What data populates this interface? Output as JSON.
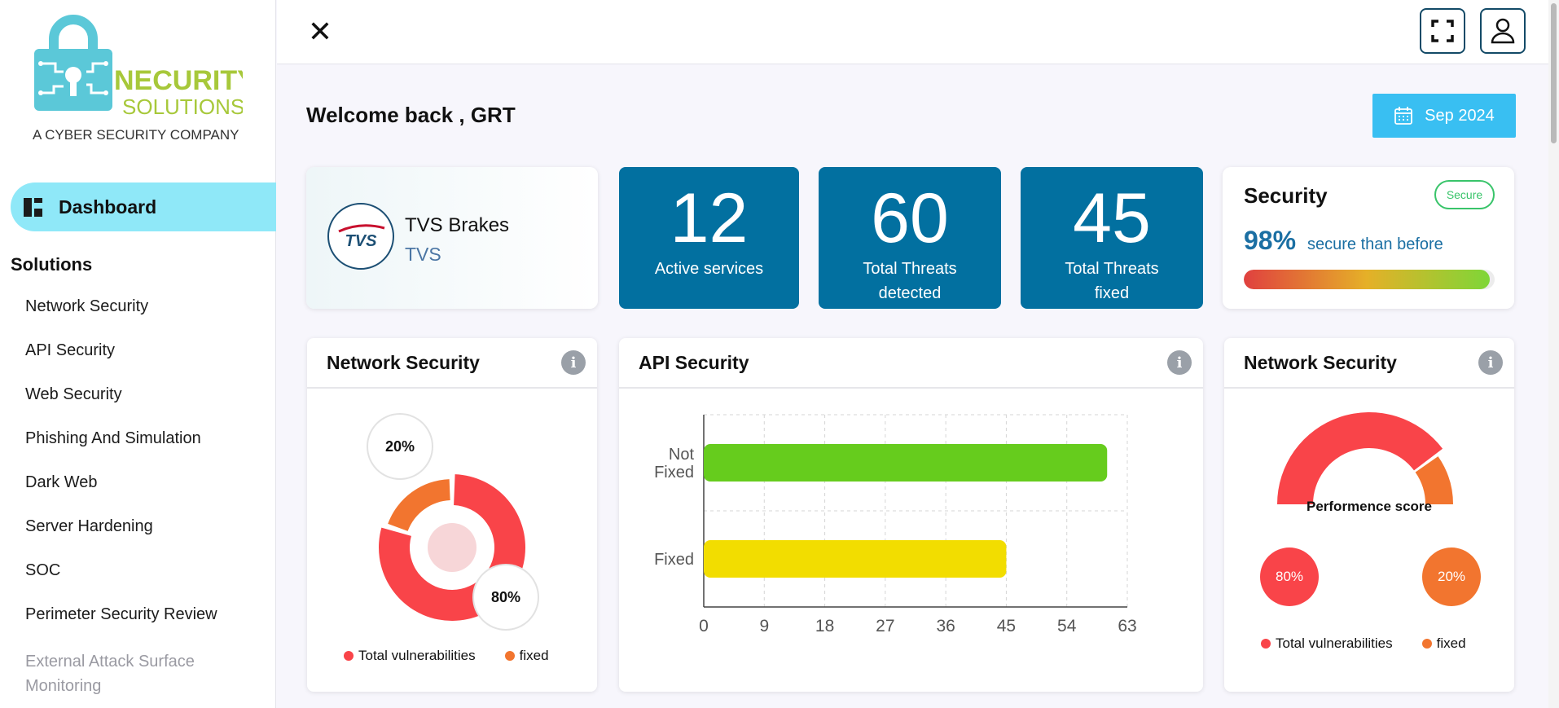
{
  "brand": {
    "name_line1": "NECURITY",
    "name_line2": "SOLUTIONS",
    "tagline": "A CYBER SECURITY COMPANY",
    "colors": {
      "teal": "#5bc8d8",
      "green": "#a7c83a"
    }
  },
  "sidebar": {
    "active_item": "Dashboard",
    "section_title": "Solutions",
    "items": [
      "Network Security",
      "API Security",
      "Web Security",
      "Phishing And Simulation",
      "Dark Web",
      "Server Hardening",
      "SOC",
      "Perimeter Security Review",
      "External Attack Surface Monitoring"
    ]
  },
  "topbar": {
    "close_icon": "close-icon",
    "fullscreen_icon": "fullscreen-icon",
    "profile_icon": "user-icon"
  },
  "header": {
    "welcome": "Welcome back , GRT",
    "date_label": "Sep 2024"
  },
  "company": {
    "logo_text": "TVS",
    "name": "TVS Brakes",
    "sub": "TVS"
  },
  "stats": [
    {
      "value": "12",
      "label_line1": "Active services",
      "label_line2": ""
    },
    {
      "value": "60",
      "label_line1": "Total Threats",
      "label_line2": "detected"
    },
    {
      "value": "45",
      "label_line1": "Total Threats",
      "label_line2": "fixed"
    }
  ],
  "security": {
    "title": "Security",
    "badge": "Secure",
    "percent": "98%",
    "text": "secure than before",
    "level": 0.98
  },
  "panels": {
    "network_security": {
      "title": "Network Security",
      "slice_large": "80%",
      "slice_small": "20%",
      "legend": [
        "Total vulnerabilities",
        "fixed"
      ]
    },
    "api_security": {
      "title": "API Security"
    },
    "network_security_gauge": {
      "title": "Network Security",
      "center_label": "Performence score",
      "left_pct": "80%",
      "right_pct": "20%",
      "legend": [
        "Total vulnerabilities",
        "fixed"
      ]
    }
  },
  "chart_data": [
    {
      "type": "pie",
      "categories": [
        "Total vulnerabilities",
        "fixed"
      ],
      "values": [
        80,
        20
      ],
      "colors": [
        "#f94449",
        "#f2752f"
      ]
    },
    {
      "type": "bar",
      "orientation": "horizontal",
      "categories": [
        "Not Fixed",
        "Fixed"
      ],
      "values": [
        60,
        45
      ],
      "colors": [
        "#66cc1d",
        "#f2dd00"
      ],
      "xticks": [
        "0",
        "9",
        "18",
        "27",
        "36",
        "45",
        "54",
        "63"
      ],
      "xlim": [
        0,
        63
      ],
      "grid": true
    },
    {
      "type": "pie",
      "style": "semi-circle gauge",
      "categories": [
        "Total vulnerabilities",
        "fixed"
      ],
      "values": [
        80,
        20
      ],
      "colors": [
        "#f94449",
        "#f2752f"
      ]
    }
  ]
}
